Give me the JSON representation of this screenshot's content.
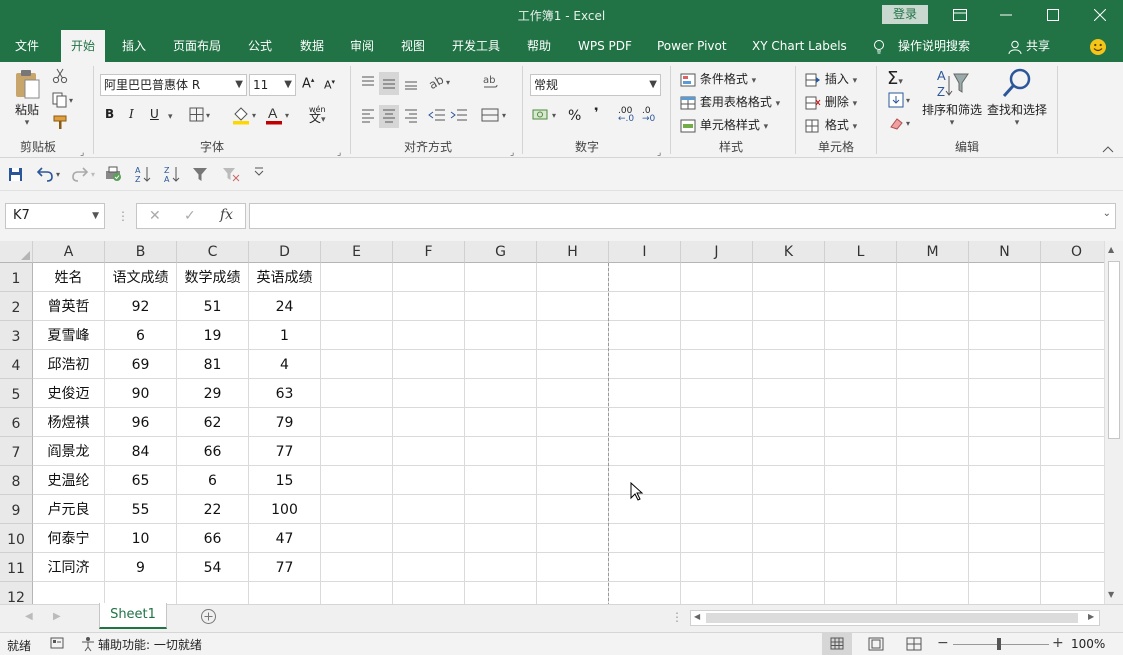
{
  "titlebar": {
    "title": "工作簿1  -  Excel",
    "login_label": "登录",
    "restore_icon": "ribbon-display-icon",
    "minimize_icon": "minimize-icon",
    "maximize_icon": "maximize-icon",
    "close_icon": "close-icon"
  },
  "tabs": [
    "文件",
    "开始",
    "插入",
    "页面布局",
    "公式",
    "数据",
    "审阅",
    "视图",
    "开发工具",
    "帮助",
    "WPS PDF",
    "Power Pivot",
    "XY Chart Labels"
  ],
  "tell_me": "操作说明搜索",
  "share": "共享",
  "ribbon": {
    "clipboard": {
      "paste": "粘贴",
      "label": "剪贴板"
    },
    "font": {
      "name": "阿里巴巴普惠体 R",
      "size": "11",
      "bold": "B",
      "italic": "I",
      "underline": "U",
      "label": "字体",
      "wen": "wén",
      "wen_char": "文"
    },
    "alignment": {
      "label": "对齐方式"
    },
    "number": {
      "format": "常规",
      "percent": "%",
      "comma": "❜",
      "inc_dec": ".00",
      "dec_dec": ".0",
      "label": "数字"
    },
    "styles": {
      "cond": "条件格式",
      "table": "套用表格格式",
      "cell": "单元格样式",
      "label": "样式"
    },
    "cells": {
      "insert": "插入",
      "delete": "删除",
      "format": "格式",
      "label": "单元格"
    },
    "editing": {
      "sort": "排序和筛选",
      "find": "查找和选择",
      "label": "编辑"
    }
  },
  "formula": {
    "namebox": "K7",
    "fx": "fx",
    "value": ""
  },
  "columns": [
    "A",
    "B",
    "C",
    "D",
    "E",
    "F",
    "G",
    "H",
    "I",
    "J",
    "K",
    "L",
    "M",
    "N",
    "O"
  ],
  "rows": [
    "1",
    "2",
    "3",
    "4",
    "5",
    "6",
    "7",
    "8",
    "9",
    "10",
    "11",
    "12"
  ],
  "table": {
    "headers": [
      "姓名",
      "语文成绩",
      "数学成绩",
      "英语成绩"
    ],
    "data": [
      [
        "曾英哲",
        "92",
        "51",
        "24"
      ],
      [
        "夏雪峰",
        "6",
        "19",
        "1"
      ],
      [
        "邱浩初",
        "69",
        "81",
        "4"
      ],
      [
        "史俊迈",
        "90",
        "29",
        "63"
      ],
      [
        "杨煜祺",
        "96",
        "62",
        "79"
      ],
      [
        "阎景龙",
        "84",
        "66",
        "77"
      ],
      [
        "史温纶",
        "65",
        "6",
        "15"
      ],
      [
        "卢元良",
        "55",
        "22",
        "100"
      ],
      [
        "何泰宁",
        "10",
        "66",
        "47"
      ],
      [
        "江同济",
        "9",
        "54",
        "77"
      ]
    ]
  },
  "sheet": {
    "name": "Sheet1"
  },
  "status": {
    "ready": "就绪",
    "accessibility": "辅助功能: 一切就绪",
    "zoom": "100%"
  },
  "colors": {
    "brand": "#217346",
    "grid": "#dadada",
    "header_bg": "#e9e9e9"
  }
}
